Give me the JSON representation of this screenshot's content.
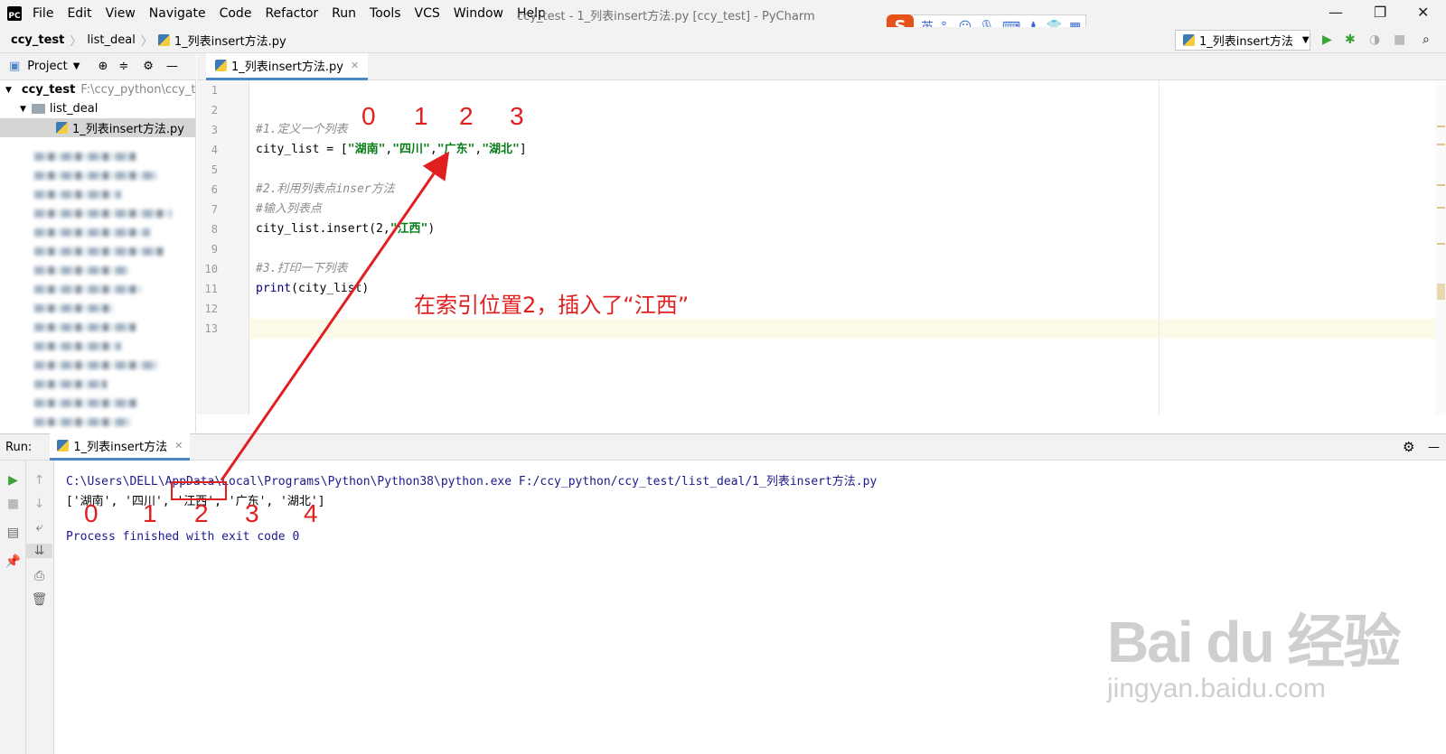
{
  "window": {
    "title": "ccy_test - 1_列表insert方法.py [ccy_test] - PyCharm",
    "menu": [
      "File",
      "Edit",
      "View",
      "Navigate",
      "Code",
      "Refactor",
      "Run",
      "Tools",
      "VCS",
      "Window",
      "Help"
    ]
  },
  "ime_toolbar": {
    "logo": "S",
    "lang": "英"
  },
  "breadcrumb": {
    "project": "ccy_test",
    "folder": "list_deal",
    "file": "1_列表insert方法.py"
  },
  "run_config": {
    "label": "1_列表insert方法"
  },
  "project_panel": {
    "label": "Project",
    "root_name": "ccy_test",
    "root_path": "F:\\ccy_python\\ccy_t",
    "folder": "list_deal",
    "file": "1_列表insert方法.py"
  },
  "editor": {
    "tab_label": "1_列表insert方法.py",
    "line_numbers": [
      "1",
      "2",
      "3",
      "4",
      "5",
      "6",
      "7",
      "8",
      "9",
      "10",
      "11",
      "12",
      "13"
    ],
    "lines": {
      "l3": "#1.定义一个列表",
      "l4_a": "city_list = [",
      "l4_s1": "\"湖南\"",
      "l4_s2": "\"四川\"",
      "l4_s3": "\"广东\"",
      "l4_s4": "\"湖北\"",
      "l6": "#2.利用列表点inser方法",
      "l7": "#输入列表点",
      "l8_a": "city_list.insert(2,",
      "l8_s": "\"江西\"",
      "l8_b": ")",
      "l10": "#3.打印一下列表",
      "l11_fn": "print",
      "l11_rest": "(city_list)"
    }
  },
  "run_panel": {
    "label": "Run:",
    "tab_label": "1_列表insert方法",
    "cmd": "C:\\Users\\DELL\\AppData\\Local\\Programs\\Python\\Python38\\python.exe F:/ccy_python/ccy_test/list_deal/1_列表insert方法.py",
    "output": "['湖南', '四川', '江西', '广东', '湖北']",
    "exit": "Process finished with exit code 0"
  },
  "annotations": {
    "top_indices": [
      "0",
      "1",
      "2",
      "3"
    ],
    "bottom_indices": [
      "0",
      "1",
      "2",
      "3",
      "4"
    ],
    "note": "在索引位置2，插入了“江西”",
    "color": "#e02020"
  },
  "watermark": {
    "brand": "Bai du 经验",
    "url": "jingyan.baidu.com"
  }
}
